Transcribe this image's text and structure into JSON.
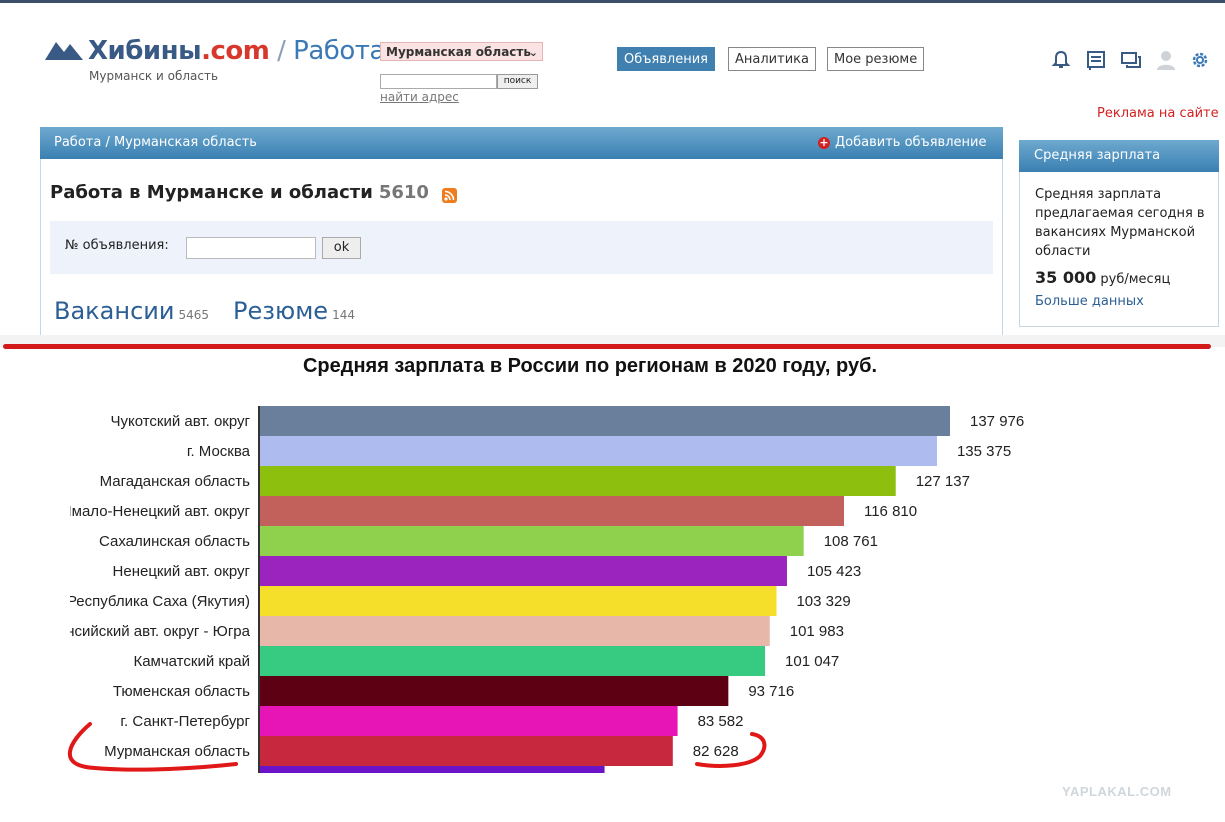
{
  "header": {
    "logo_main": "Хибины",
    "logo_com": ".com",
    "logo_sep": " / ",
    "logo_section": "Работа",
    "logo_sub": "Мурманск и область",
    "region_select": "Мурманская область",
    "search_button": "поиск",
    "find_address": "найти адрес",
    "nav": [
      {
        "label": "Объявления",
        "active": true
      },
      {
        "label": "Аналитика",
        "active": false
      },
      {
        "label": "Мое резюме",
        "active": false
      }
    ],
    "icons": [
      "bell-icon",
      "news-icon",
      "chat-icon",
      "user-icon",
      "gear-icon"
    ],
    "ad_link": "Реклама на сайте"
  },
  "panel": {
    "breadcrumb": "Работа / Мурманская область",
    "add_ad": "Добавить объявление",
    "title": "Работа в Мурманске и области",
    "title_count": "5610",
    "filter_label": "№ объявления:",
    "filter_button": "ok",
    "tabs": [
      {
        "label": "Вакансии",
        "count": "5465"
      },
      {
        "label": "Резюме",
        "count": "144"
      }
    ]
  },
  "sidebar": {
    "title": "Средняя зарплата",
    "text": "Средняя зарплата предлагаемая сегодня в вакансиях Мурманской области",
    "salary_value": "35 000",
    "salary_unit": "руб/месяц",
    "more_link": "Больше данных"
  },
  "colors": {
    "accent_blue": "#3f80b0",
    "red_line": "#d21a1a",
    "ad_red": "#d32020"
  },
  "watermark": "YAPLAKAL.COM",
  "chart_data": {
    "type": "bar",
    "orientation": "horizontal",
    "title": "Средняя зарплата в России по регионам в 2020 году, руб.",
    "xlim": [
      0,
      140000
    ],
    "categories": [
      "Чукотский авт. округ",
      "г. Москва",
      "Магаданская область",
      "Ямало-Ненецкий  авт. округ",
      "Сахалинская область",
      "Ненецкий авт. округ",
      "Республика Саха (Якутия)",
      "Ханты-Мансийский авт. округ - Югра",
      "Камчатский край",
      "Тюменская область",
      "г. Санкт-Петербург",
      "Мурманская область"
    ],
    "values": [
      137976,
      135375,
      127137,
      116810,
      108761,
      105423,
      103329,
      101983,
      101047,
      93716,
      83582,
      82628
    ],
    "value_labels": [
      "137 976",
      "135 375",
      "127 137",
      "116 810",
      "108 761",
      "105 423",
      "103 329",
      "101 983",
      "101 047",
      "93 716",
      "83 582",
      "82 628"
    ],
    "colors": [
      "#6a7f9c",
      "#aebbef",
      "#8cbf0e",
      "#c2605c",
      "#8fd14d",
      "#9b23be",
      "#f5df2a",
      "#e7b8aa",
      "#37cb82",
      "#5e0013",
      "#e815b6",
      "#c8283e"
    ],
    "partial_bar": {
      "value": 69000,
      "color": "#6a13c8"
    },
    "highlight_index": 11,
    "grid": false
  }
}
